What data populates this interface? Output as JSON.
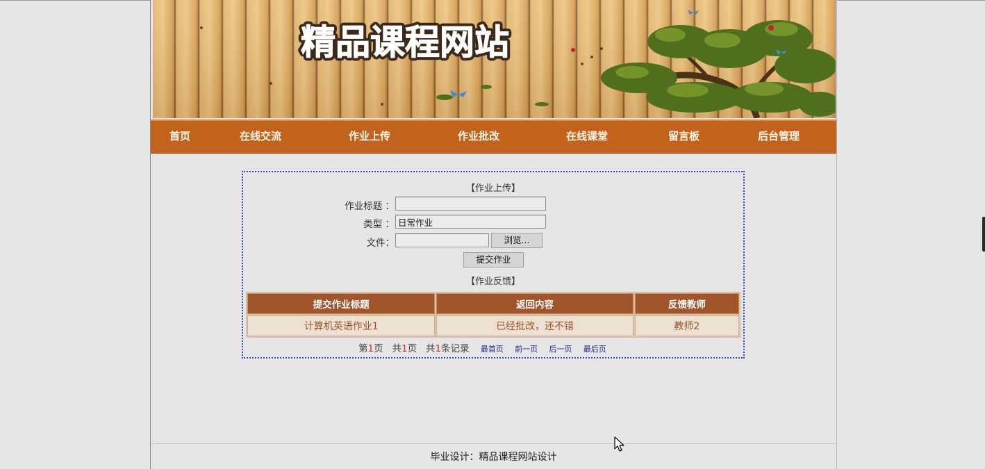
{
  "banner": {
    "logo_text": "精品课程网站"
  },
  "nav": {
    "items": [
      {
        "label": "首页"
      },
      {
        "label": "在线交流"
      },
      {
        "label": "作业上传"
      },
      {
        "label": "作业批改"
      },
      {
        "label": "在线课堂"
      },
      {
        "label": "留言板"
      },
      {
        "label": "后台管理"
      }
    ]
  },
  "upload": {
    "section_title": "【作业上传】",
    "title_label": "作业标题 ：",
    "title_value": "",
    "type_label": "类型 ：",
    "type_value": "日常作业",
    "file_label": "文件：",
    "file_value": "",
    "browse_label": "浏览...",
    "submit_label": "提交作业"
  },
  "feedback": {
    "section_title": "【作业反馈】",
    "columns": [
      "提交作业标题",
      "返回内容",
      "反馈教师"
    ],
    "rows": [
      [
        "计算机英语作业1",
        "已经批改，还不错",
        "教师2"
      ]
    ]
  },
  "pager": {
    "page_prefix": "第",
    "page_num": "1",
    "page_suffix": "页",
    "total_pages_prefix": "共",
    "total_pages": "1",
    "total_pages_suffix": "页",
    "total_records_prefix": "共",
    "total_records": "1",
    "total_records_suffix": "条记录",
    "first": "最首页",
    "prev": "前一页",
    "next": "后一页",
    "last": "最后页"
  },
  "footer": {
    "text": "毕业设计：精品课程网站设计"
  }
}
